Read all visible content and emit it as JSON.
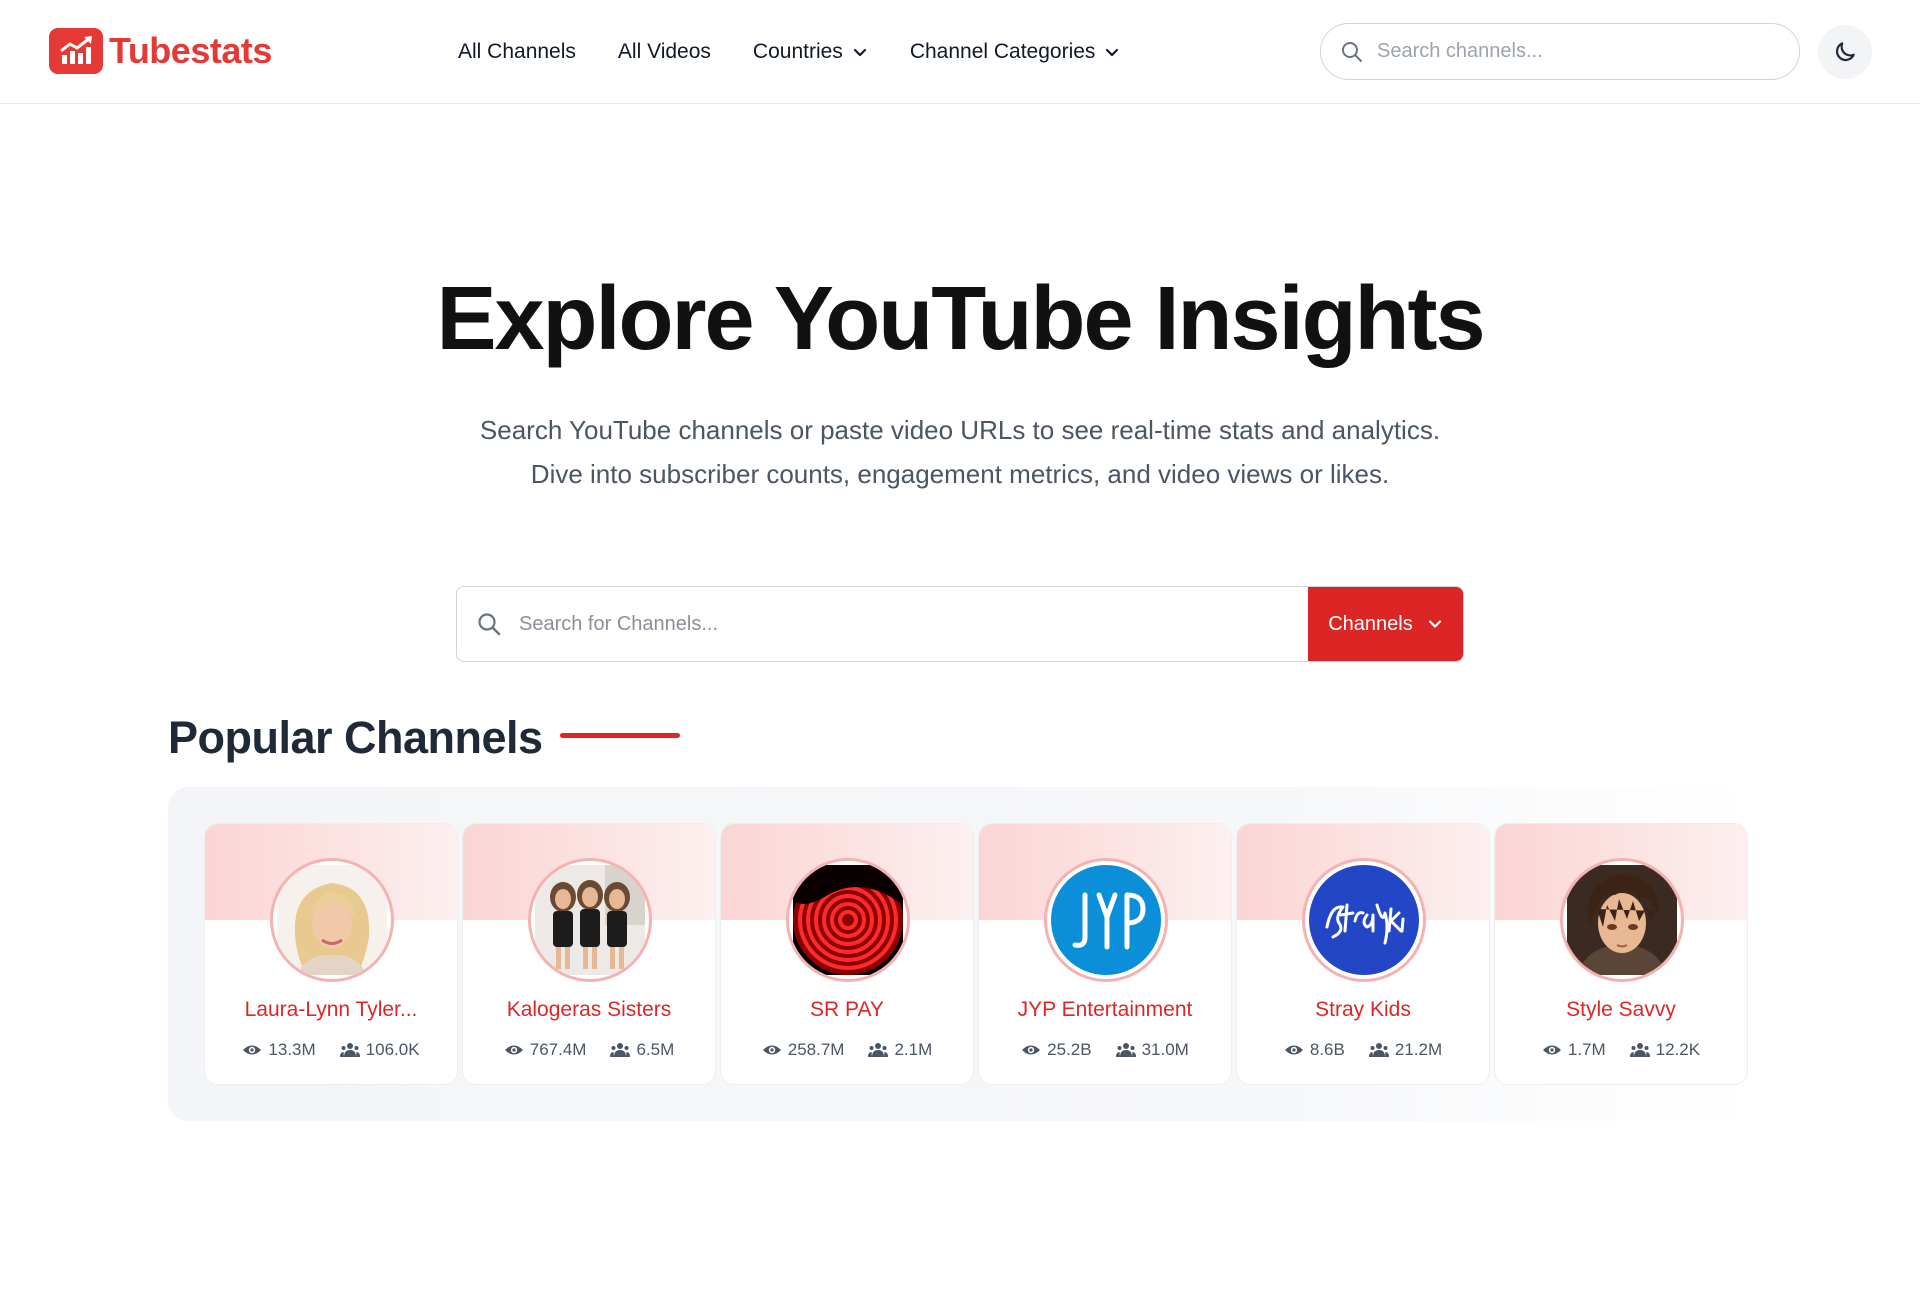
{
  "brand": {
    "name": "Tubestats",
    "accent": "#e53935",
    "icon": "chart-logo-icon"
  },
  "nav": {
    "items": [
      {
        "label": "All Channels",
        "dropdown": false
      },
      {
        "label": "All Videos",
        "dropdown": false
      },
      {
        "label": "Countries",
        "dropdown": true
      },
      {
        "label": "Channel Categories",
        "dropdown": true
      }
    ]
  },
  "header_search": {
    "placeholder": "Search channels..."
  },
  "theme_toggle": {
    "icon": "moon-icon"
  },
  "hero": {
    "title": "Explore YouTube Insights",
    "subtitle_line1": "Search YouTube channels or paste video URLs to see real-time stats and analytics.",
    "subtitle_line2": "Dive into subscriber counts, engagement metrics, and video views or likes."
  },
  "main_search": {
    "placeholder": "Search for Channels...",
    "type_label": "Channels"
  },
  "popular": {
    "title": "Popular Channels",
    "channels": [
      {
        "name": "Laura-Lynn Tyler...",
        "views": "13.3M",
        "subscribers": "106.0K",
        "avatar": "portrait-blonde"
      },
      {
        "name": "Kalogeras Sisters",
        "views": "767.4M",
        "subscribers": "6.5M",
        "avatar": "group-three"
      },
      {
        "name": "SR PAY",
        "views": "258.7M",
        "subscribers": "2.1M",
        "avatar": "red-spiral"
      },
      {
        "name": "JYP Entertainment",
        "views": "25.2B",
        "subscribers": "31.0M",
        "avatar": "jyp-logo"
      },
      {
        "name": "Stray Kids",
        "views": "8.6B",
        "subscribers": "21.2M",
        "avatar": "straykids-logo"
      },
      {
        "name": "Style Savvy",
        "views": "1.7M",
        "subscribers": "12.2K",
        "avatar": "anime-portrait"
      }
    ]
  },
  "colors": {
    "primary_red": "#dc2626",
    "band_pink": "#fbd5d5",
    "jyp_blue": "#0a8fd8",
    "straykids_blue": "#2346c7"
  }
}
